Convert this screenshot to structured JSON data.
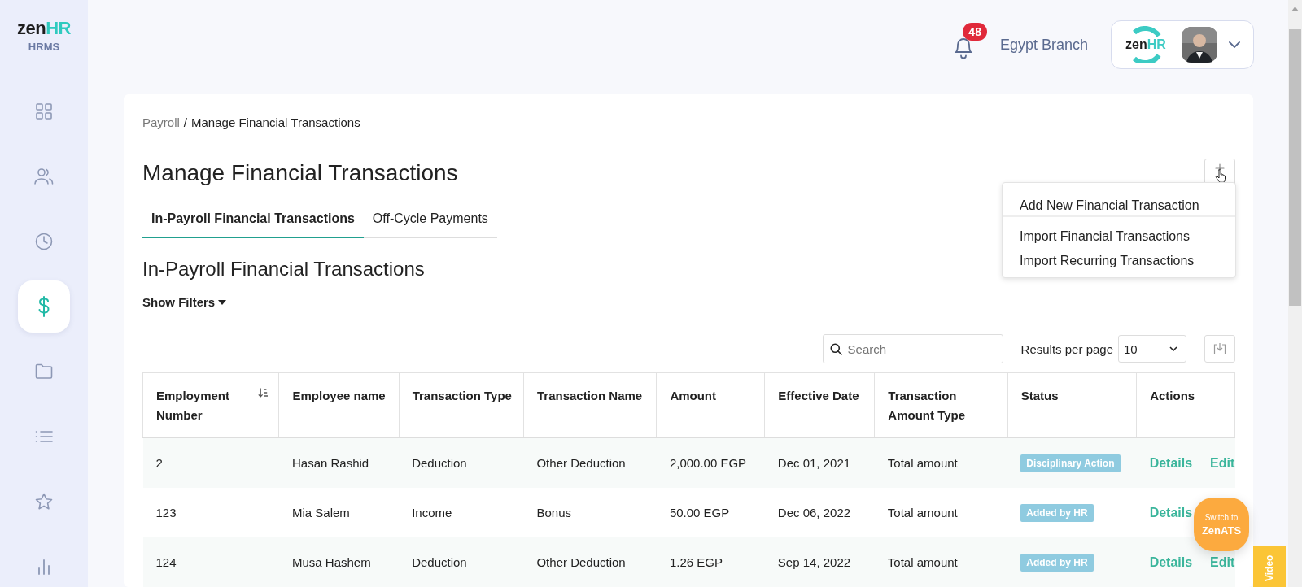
{
  "sidebar": {
    "logo_main": "zen",
    "logo_accent": "HR",
    "product": "HRMS",
    "items": [
      {
        "selected": false
      },
      {
        "selected": false
      },
      {
        "selected": false
      },
      {
        "selected": true
      },
      {
        "selected": false
      },
      {
        "selected": false
      },
      {
        "selected": false
      },
      {
        "selected": false
      }
    ]
  },
  "header": {
    "notifications": "48",
    "branch": "Egypt Branch",
    "company_logo_main": "zen",
    "company_logo_accent": "HR"
  },
  "breadcrumb": {
    "parent": "Payroll",
    "separator": "/",
    "current": "Manage Financial Transactions"
  },
  "title": "Manage Financial Transactions",
  "add_menu": {
    "groups": [
      [
        "Add New Financial Transaction"
      ],
      [
        "Import Financial Transactions",
        "Import Recurring Transactions"
      ]
    ]
  },
  "tabs": [
    {
      "label": "In-Payroll Financial Transactions",
      "selected": true
    },
    {
      "label": "Off-Cycle Payments",
      "selected": false
    }
  ],
  "section_title": "In-Payroll Financial Transactions",
  "filters_toggle": "Show Filters",
  "search": {
    "placeholder": "Search"
  },
  "results_per_page": {
    "label": "Results per page",
    "value": "10"
  },
  "table": {
    "columns": [
      {
        "label": "Employment Number",
        "sortable": true
      },
      {
        "label": "Employee name",
        "sortable": false
      },
      {
        "label": "Transaction Type",
        "sortable": false
      },
      {
        "label": "Transaction Name",
        "sortable": false
      },
      {
        "label": "Amount",
        "sortable": false
      },
      {
        "label": "Effective Date",
        "sortable": false
      },
      {
        "label": "Transaction Amount Type",
        "sortable": false
      },
      {
        "label": "Status",
        "sortable": false
      },
      {
        "label": "Actions",
        "sortable": false
      }
    ],
    "rows": [
      {
        "cells": [
          "2",
          "Hasan Rashid",
          "Deduction",
          "Other Deduction",
          "2,000.00 EGP",
          "Dec 01, 2021",
          "Total amount"
        ],
        "status": "Disciplinary Action",
        "actions": [
          "Details",
          "Edit"
        ]
      },
      {
        "cells": [
          "123",
          "Mia Salem",
          "Income",
          "Bonus",
          "50.00 EGP",
          "Dec 06, 2022",
          "Total amount"
        ],
        "status": "Added by HR",
        "actions": [
          "Details"
        ]
      },
      {
        "cells": [
          "124",
          "Musa Hashem",
          "Deduction",
          "Other Deduction",
          "1.26 EGP",
          "Sep 14, 2022",
          "Total amount"
        ],
        "status": "Added by HR",
        "actions": [
          "Details",
          "Edit"
        ]
      }
    ]
  },
  "switch_bubble": {
    "line1": "Switch to",
    "line2": "ZenATS"
  },
  "video_tab": "Video"
}
